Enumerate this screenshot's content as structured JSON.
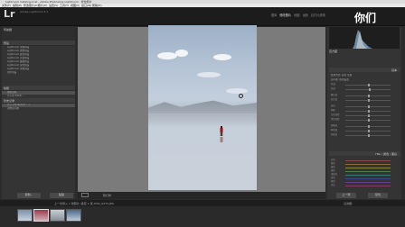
{
  "window": {
    "title": "Lightroom Catalog.lrcat - Adobe Photoshop Lightroom - 修改照片"
  },
  "menu": [
    "文件(F)",
    "编辑(E)",
    "修改照片(D)",
    "照片(P)",
    "设置(S)",
    "工具(T)",
    "视图(V)",
    "窗口(W)",
    "帮助(H)"
  ],
  "identity": {
    "logo": "Lr",
    "catalog": "Adobe Lightroom 5.7"
  },
  "modules": [
    {
      "label": "图库",
      "active": false
    },
    {
      "label": "修改照片",
      "active": true
    },
    {
      "label": "地图",
      "active": false
    },
    {
      "label": "画册",
      "active": false
    },
    {
      "label": "幻灯片放映",
      "active": false
    }
  ],
  "overlay_text": "你们",
  "left_panel": {
    "navigator": "导航器",
    "presets_header": "预设",
    "presets": [
      "Lightroom 常规预设",
      "Lightroom 效果预设",
      "Lightroom 颜色预设",
      "Lightroom 黑白预设",
      "Lightroom 曲线预设",
      "Lightroom 锐化预设",
      "Lightroom 常规预设",
      "用户预设"
    ],
    "snapshots_header": "快照",
    "snapshots": [
      "快照名称",
      "导入时 2016/..."
    ],
    "history_header": "历史记录",
    "history": [
      "导入 (2016/1/27 ...)",
      "调整白平衡"
    ],
    "copy_label": "复制...",
    "paste_label": "粘贴"
  },
  "right_panel": {
    "histogram_label": "直方图",
    "basic_header": "基本",
    "treatment": "处理方式: 彩色  黑白",
    "wb_label": "白平衡: 原照设置",
    "sliders": [
      "色温",
      "色调",
      "曝光度",
      "对比度",
      "高光",
      "阴影",
      "白色色阶",
      "黑色色阶",
      "清晰度",
      "鲜艳度",
      "饱和度"
    ],
    "hsl_header": "HSL / 颜色 / 黑白",
    "hsl_sliders": [
      "红色",
      "橙色",
      "黄色",
      "绿色",
      "浅绿色",
      "蓝色",
      "紫色",
      "洋红"
    ],
    "prev_label": "上一张",
    "reset_label": "复位"
  },
  "toolbar": {
    "softproof": "软打样"
  },
  "filmstrip": {
    "info": "上一次导入  1 张照片 /选定 1 张 /DSC_0275.JPG",
    "filter": "过滤器:"
  }
}
